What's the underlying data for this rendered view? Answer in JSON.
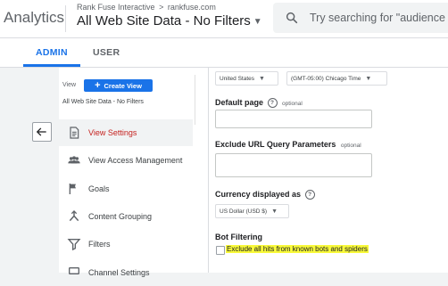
{
  "header": {
    "app_title": "Analytics",
    "account": "Rank Fuse Interactive",
    "breadcrumb_sep": ">",
    "property": "rankfuse.com",
    "view_title": "All Web Site Data - No Filters",
    "search_placeholder": "Try searching for \"audience ov"
  },
  "tabs": [
    {
      "label": "ADMIN",
      "active": true
    },
    {
      "label": "USER",
      "active": false
    }
  ],
  "nav": {
    "view_label": "View",
    "create_view_label": "Create View",
    "view_name": "All Web Site Data - No Filters",
    "items": [
      {
        "label": "View Settings",
        "icon": "document-icon",
        "active": true
      },
      {
        "label": "View Access Management",
        "icon": "people-icon",
        "active": false
      },
      {
        "label": "Goals",
        "icon": "flag-icon",
        "active": false
      },
      {
        "label": "Content Grouping",
        "icon": "grouping-icon",
        "active": false
      },
      {
        "label": "Filters",
        "icon": "filter-icon",
        "active": false
      },
      {
        "label": "Channel Settings",
        "icon": "channel-icon",
        "active": false
      }
    ]
  },
  "settings": {
    "country": "United States",
    "timezone": "(GMT-05:00) Chicago Time",
    "default_page_label": "Default page",
    "default_page_optional": "optional",
    "default_page_value": "",
    "exclude_params_label": "Exclude URL Query Parameters",
    "exclude_params_optional": "optional",
    "exclude_params_value": "",
    "currency_label": "Currency displayed as",
    "currency_value": "US Dollar (USD $)",
    "bot_filtering_label": "Bot Filtering",
    "bot_filtering_option": "Exclude all hits from known bots and spiders",
    "bot_filtering_checked": false
  },
  "colors": {
    "accent": "#1a73e8",
    "active_nav_text": "#c5221f",
    "highlight": "#f8f93a"
  }
}
